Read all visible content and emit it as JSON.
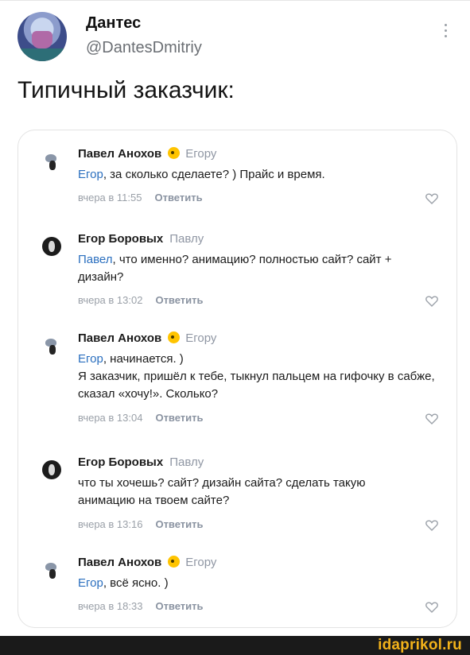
{
  "tweet": {
    "author_name": "Дантес",
    "handle": "@DantesDmitriy",
    "text": "Типичный заказчик:"
  },
  "comments": [
    {
      "author": "Павел Анохов",
      "has_badge": true,
      "reply_to": "Егору",
      "mention": "Егор",
      "text_after_mention": ", за сколько сделаете? ) Прайс и время.",
      "time": "вчера в 11:55",
      "reply_label": "Ответить"
    },
    {
      "author": "Егор Боровых",
      "has_badge": false,
      "reply_to": "Павлу",
      "mention": "Павел",
      "text_after_mention": ", что именно? анимацию? полностью сайт? сайт + дизайн?",
      "time": "вчера в 13:02",
      "reply_label": "Ответить"
    },
    {
      "author": "Павел Анохов",
      "has_badge": true,
      "reply_to": "Егору",
      "mention": "Егор",
      "text_after_mention": ", начинается. )",
      "text_extra": "Я заказчик, пришёл к тебе, тыкнул пальцем на гифочку в сабже, сказал «хочу!». Сколько?",
      "time": "вчера в 13:04",
      "reply_label": "Ответить"
    },
    {
      "author": "Егор Боровых",
      "has_badge": false,
      "reply_to": "Павлу",
      "mention": "",
      "text_after_mention": "что ты хочешь? сайт? дизайн сайта? сделать такую анимацию на твоем сайте?",
      "time": "вчера в 13:16",
      "reply_label": "Ответить"
    },
    {
      "author": "Павел Анохов",
      "has_badge": true,
      "reply_to": "Егору",
      "mention": "Егор",
      "text_after_mention": ", всё ясно. )",
      "time": "вчера в 18:33",
      "reply_label": "Ответить"
    }
  ],
  "watermark": "idaprikol.ru",
  "colors": {
    "mention": "#2b6fbf",
    "meta": "#9aa0a8",
    "badge": "#ffc400",
    "watermark": "#f2b21a"
  },
  "icons": {
    "menu": "vertical-dots-icon",
    "like": "heart-outline-icon",
    "badge": "emoji-badge-icon"
  }
}
